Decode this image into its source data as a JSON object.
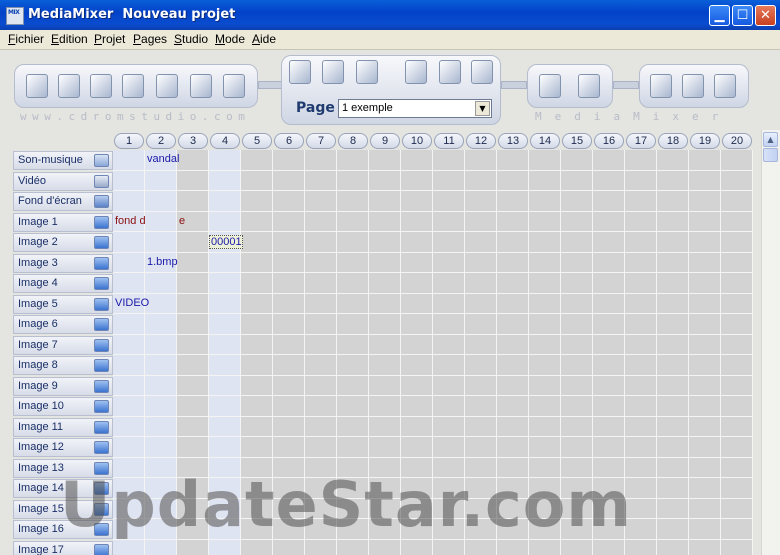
{
  "window": {
    "app_icon_text": "MIX",
    "title": "MediaMixer  Nouveau projet",
    "minimize_icon": "minimize-icon",
    "maximize_icon": "maximize-icon",
    "close_icon": "close-icon"
  },
  "menu": [
    {
      "first": "F",
      "rest": "ichier"
    },
    {
      "first": "E",
      "rest": "dition"
    },
    {
      "first": "P",
      "rest": "rojet"
    },
    {
      "first": "P",
      "rest": "ages"
    },
    {
      "first": "S",
      "rest": "tudio"
    },
    {
      "first": "M",
      "rest": "ode"
    },
    {
      "first": "A",
      "rest": "ide"
    }
  ],
  "toolbar": {
    "watermark_left": "www.cdromstudio.com",
    "watermark_right": "MediaMixer",
    "page_label": "Page",
    "page_select_value": "1  exemple",
    "icons_group1": [
      "new-project-icon",
      "open-folder-icon",
      "save-disk-icon",
      "save-as-icon",
      "cut-icon",
      "edit-icon",
      "export-icon"
    ],
    "icons_group2": [
      "page-properties-icon",
      "page-edit-icon",
      "page-copy-icon"
    ],
    "icons_group3": [
      "grid-icon",
      "puzzle-icon",
      "table-icon"
    ],
    "icons_group4": [
      "play-icon",
      "record-icon"
    ],
    "icons_group5": [
      "book-icon",
      "help-icon",
      "exit-icon"
    ]
  },
  "grid": {
    "columns": [
      "1",
      "2",
      "3",
      "4",
      "5",
      "6",
      "7",
      "8",
      "9",
      "10",
      "11",
      "12",
      "13",
      "14",
      "15",
      "16",
      "17",
      "18",
      "19",
      "20"
    ],
    "rows": [
      {
        "label": "Son-musique",
        "icon": "music-icon"
      },
      {
        "label": "Vidéo",
        "icon": "video-icon"
      },
      {
        "label": "Fond d'écran",
        "icon": "wallpaper-icon"
      },
      {
        "label": "Image 1",
        "icon": "image-icon"
      },
      {
        "label": "Image 2",
        "icon": "image-icon"
      },
      {
        "label": "Image 3",
        "icon": "image-icon"
      },
      {
        "label": "Image 4",
        "icon": "image-icon"
      },
      {
        "label": "Image 5",
        "icon": "image-icon"
      },
      {
        "label": "Image 6",
        "icon": "image-icon"
      },
      {
        "label": "Image 7",
        "icon": "image-icon"
      },
      {
        "label": "Image 8",
        "icon": "image-icon"
      },
      {
        "label": "Image 9",
        "icon": "image-icon"
      },
      {
        "label": "Image 10",
        "icon": "image-icon"
      },
      {
        "label": "Image 11",
        "icon": "image-icon"
      },
      {
        "label": "Image 12",
        "icon": "image-icon"
      },
      {
        "label": "Image 13",
        "icon": "image-icon"
      },
      {
        "label": "Image 14",
        "icon": "image-icon"
      },
      {
        "label": "Image 15",
        "icon": "image-icon"
      },
      {
        "label": "Image 16",
        "icon": "image-icon"
      },
      {
        "label": "Image 17",
        "icon": "image-icon"
      }
    ],
    "cells": [
      {
        "row": 0,
        "col": 1,
        "text": "vandal",
        "style": "blue"
      },
      {
        "row": 3,
        "col": 0,
        "text": "fond d",
        "style": "red"
      },
      {
        "row": 3,
        "col": 2,
        "text": "e",
        "style": "red"
      },
      {
        "row": 4,
        "col": 3,
        "text": "00001",
        "style": "sel"
      },
      {
        "row": 5,
        "col": 1,
        "text": "1.bmp",
        "style": "blue"
      },
      {
        "row": 7,
        "col": 0,
        "text": "VIDEO",
        "style": "blue"
      }
    ]
  },
  "watermark": "UpdateStar.com"
}
